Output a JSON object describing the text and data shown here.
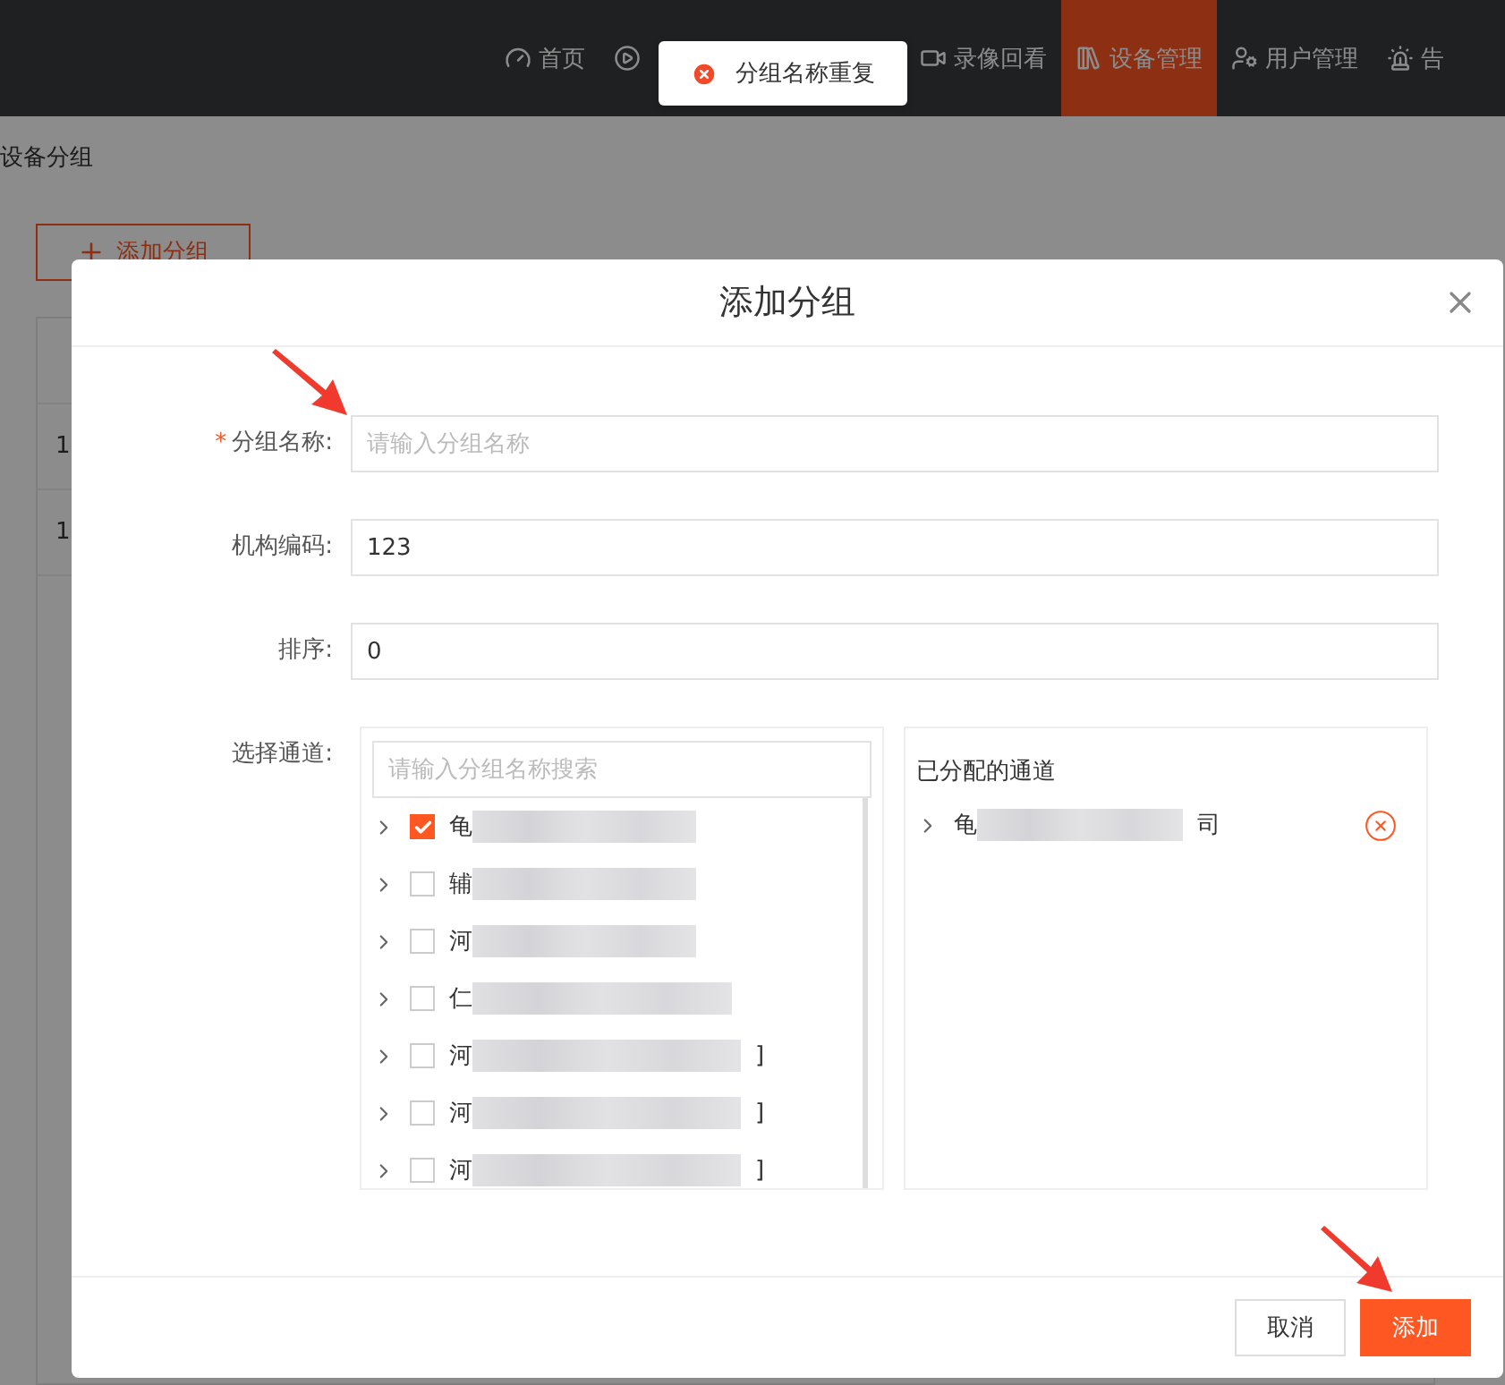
{
  "header": {
    "nav": [
      {
        "label": "首页",
        "selected": false
      },
      {
        "selected": false
      },
      {
        "label": "录像回看",
        "selected": false
      },
      {
        "label": "设备管理",
        "selected": true
      },
      {
        "label": "用户管理",
        "selected": false
      },
      {
        "label": "告",
        "selected": false
      }
    ]
  },
  "toast": {
    "kind": "error",
    "message": "分组名称重复"
  },
  "page": {
    "breadcrumb": "设备分组",
    "add_button": "添加分组",
    "table": {
      "rows": [
        [
          "1"
        ],
        [
          "1"
        ]
      ]
    }
  },
  "dialog": {
    "title": "添加分组",
    "fields": [
      {
        "label": "分组名称:",
        "required_mark": "*",
        "placeholder": "请输入分组名称"
      },
      {
        "label": "机构编码:",
        "value": "123"
      },
      {
        "label": "排序:",
        "value": "0"
      }
    ],
    "channel_picker": {
      "label": "选择通道:",
      "search_placeholder": "请输入分组名称搜索",
      "items": [
        {
          "text": "龟",
          "checked": true
        },
        {
          "text": "辅",
          "checked": false
        },
        {
          "text": "河",
          "checked": false
        },
        {
          "text": "仁",
          "checked": false
        },
        {
          "text": "河",
          "suffix": "]",
          "checked": false
        },
        {
          "text": "河",
          "suffix": "]",
          "checked": false
        },
        {
          "text": "河",
          "suffix": "]",
          "checked": false
        }
      ],
      "assigned_title": "已分配的通道",
      "assigned": [
        {
          "text": "龟",
          "suffix": "司"
        }
      ]
    },
    "buttons": [
      {
        "label": "取消",
        "kind": "default"
      },
      {
        "label": "添加",
        "kind": "primary"
      }
    ]
  }
}
